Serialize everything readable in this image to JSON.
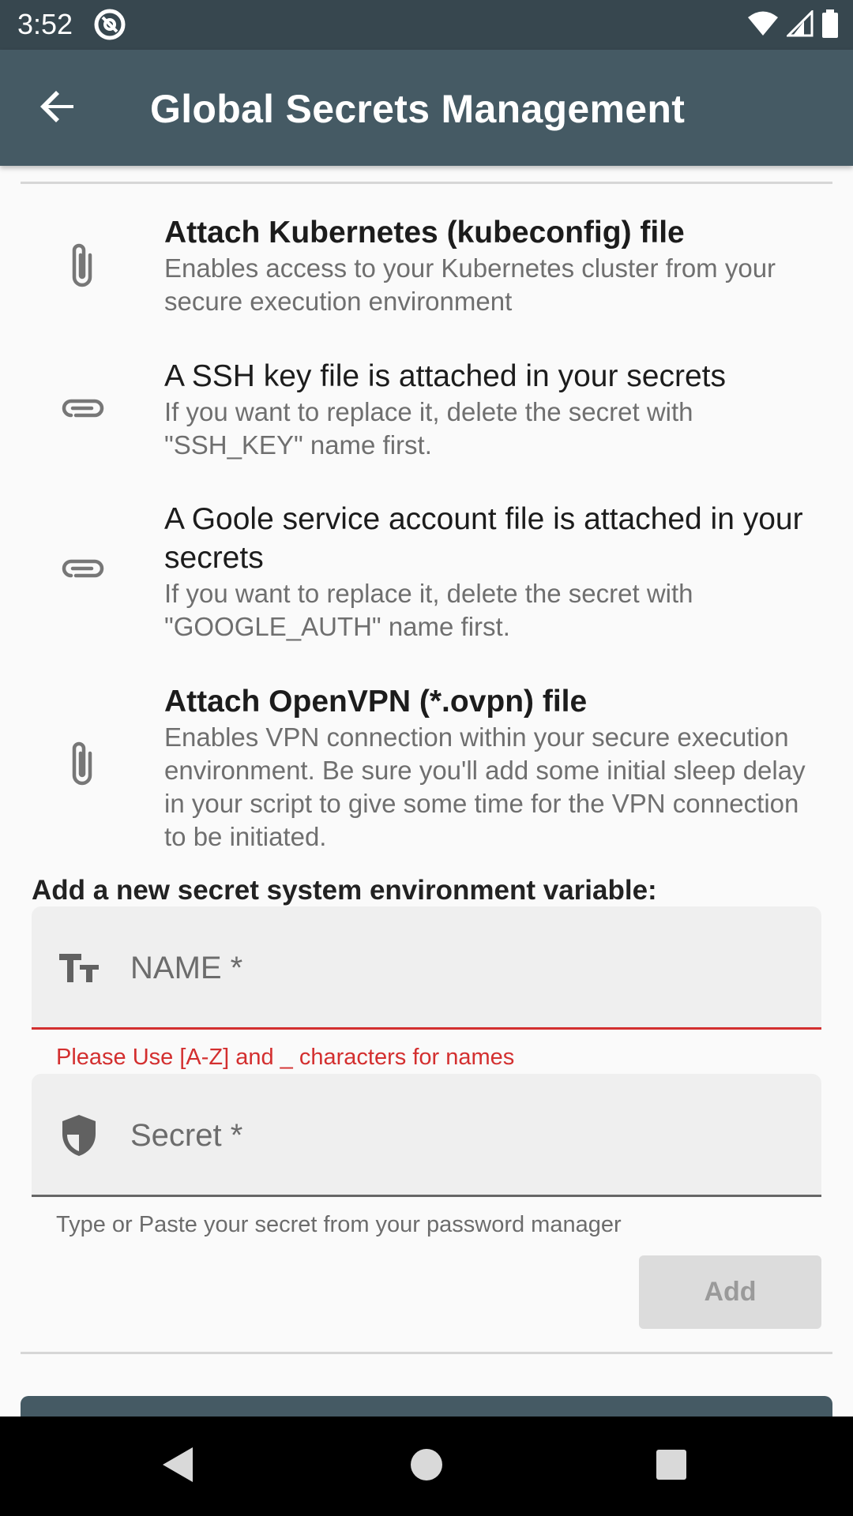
{
  "status_bar": {
    "time": "3:52",
    "icons": [
      "at-sign-icon",
      "wifi-icon",
      "signal-icon",
      "battery-icon"
    ]
  },
  "app_bar": {
    "title": "Global Secrets Management",
    "back_icon": "arrow-back-icon"
  },
  "items": [
    {
      "icon": "paperclip-icon",
      "title": "Attach Kubernetes (kubeconfig) file",
      "subtitle": "Enables access to your Kubernetes cluster from your secure execution environment"
    },
    {
      "icon": "attachment-icon",
      "title": "A SSH key file is attached in your secrets",
      "subtitle": "If you want to replace it, delete the secret with \"SSH_KEY\" name first."
    },
    {
      "icon": "attachment-icon",
      "title": "A Goole service account file is attached in your secrets",
      "subtitle": "If you want to replace it, delete the secret with \"GOOGLE_AUTH\" name first."
    },
    {
      "icon": "paperclip-icon",
      "title": "Attach OpenVPN (*.ovpn) file",
      "subtitle": "Enables VPN connection within your secure execution environment. Be sure you'll add some initial sleep delay in your script to give some time for the VPN connection to be initiated."
    }
  ],
  "form": {
    "section_label": "Add a new secret system environment variable:",
    "name_field": {
      "placeholder": "NAME *",
      "value": "",
      "icon": "text-fields-icon",
      "error": "Please Use [A-Z] and _ characters for names"
    },
    "secret_field": {
      "placeholder": "Secret *",
      "value": "",
      "icon": "shield-icon",
      "helper": "Type or Paste your secret from your password manager"
    },
    "add_label": "Add"
  },
  "colors": {
    "app_bar": "#455a64",
    "status_bar": "#37474f",
    "error": "#d32f2f",
    "background": "#fafafa"
  }
}
